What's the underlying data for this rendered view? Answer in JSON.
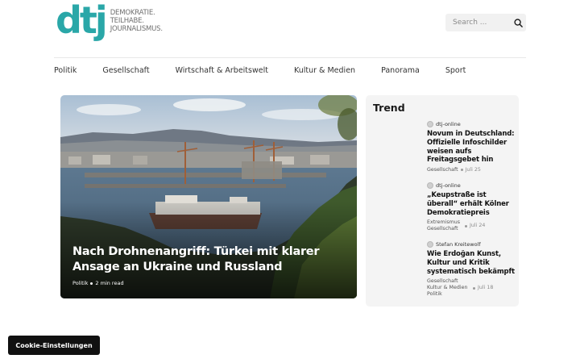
{
  "brand": {
    "logo_text": "dtj",
    "tagline": [
      "DEMOKRATIE.",
      "TEILHABE.",
      "JOURNALISMUS."
    ],
    "accent_color": "#2aa7a8"
  },
  "search": {
    "placeholder": "Search ...",
    "icon": "search-icon"
  },
  "nav": {
    "items": [
      "Politik",
      "Gesellschaft",
      "Wirtschaft & Arbeitswelt",
      "Kultur & Medien",
      "Panorama",
      "Sport"
    ]
  },
  "hero": {
    "title": "Nach Drohnenangriff: Türkei mit klarer Ansage an Ukraine und Russland",
    "category": "Politik",
    "read_time": "2 min read"
  },
  "trend": {
    "title": "Trend",
    "items": [
      {
        "author": "dtj-online",
        "headline": "Novum in Deutschland: Offizielle Infoschilder weisen aufs Freitagsgebet hin",
        "categories": "Gesellschaft",
        "date": "Juli 25"
      },
      {
        "author": "dtj-online",
        "headline": "„Keupstraße ist überall“ erhält Kölner Demokratiepreis",
        "categories": "Extremismus Gesellschaft",
        "date": "Juli 24"
      },
      {
        "author": "Stefan Kreitewolf",
        "headline": "Wie Erdoğan Kunst, Kultur und Kritik systematisch bekämpft",
        "categories": "Gesellschaft Kultur & Medien",
        "categories_extra": "Politik",
        "date": "Juli 18"
      }
    ]
  },
  "cookie": {
    "label": "Cookie-Einstellungen"
  }
}
